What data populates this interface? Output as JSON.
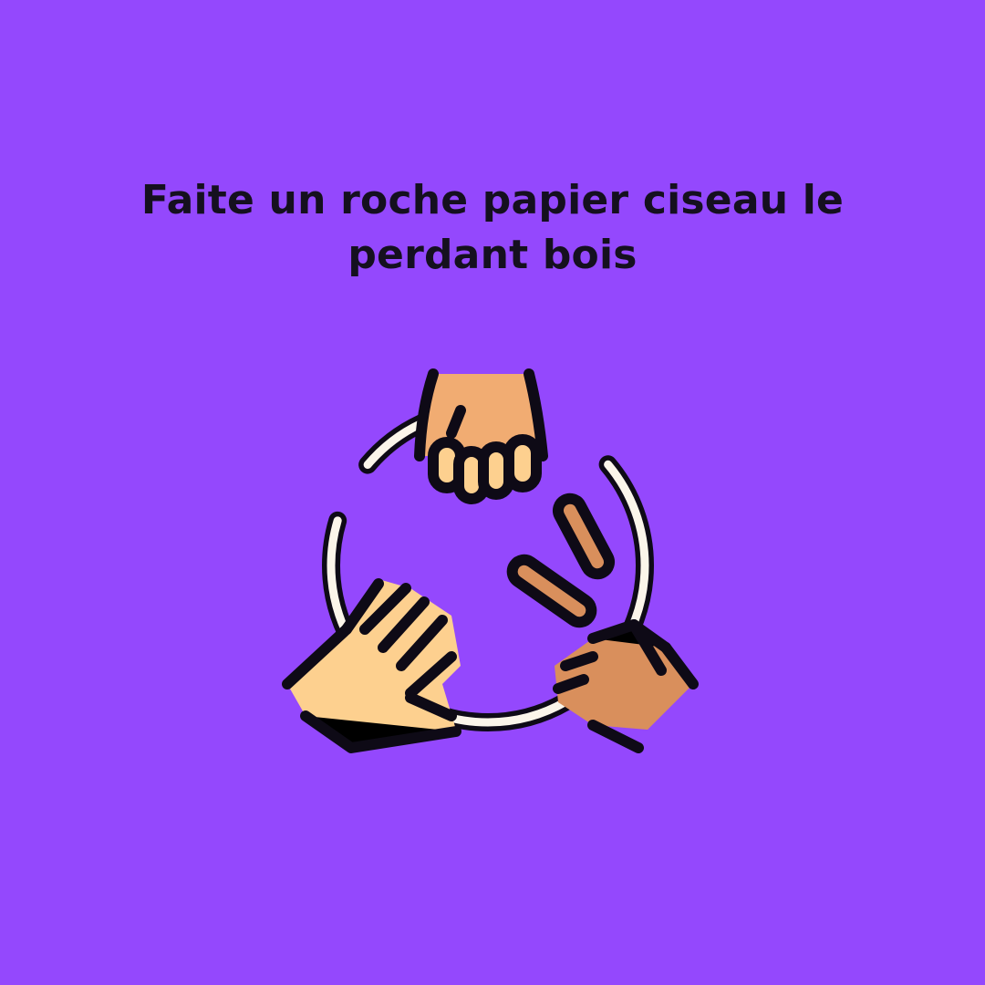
{
  "card": {
    "prompt": "Faite un roche papier ciseau le perdant bois",
    "background_color": "#9448fd",
    "text_color": "#15101f"
  },
  "illustration": {
    "icon": "rock-paper-scissors-icon",
    "hands": [
      "rock-fist-icon",
      "paper-hand-icon",
      "scissors-hand-icon"
    ],
    "colors": {
      "outline": "#0e0a16",
      "ring": "#fbf5ea",
      "skin_light": "#fdd08f",
      "skin_mid": "#f1ac72",
      "skin_dark": "#d98f5c"
    }
  }
}
